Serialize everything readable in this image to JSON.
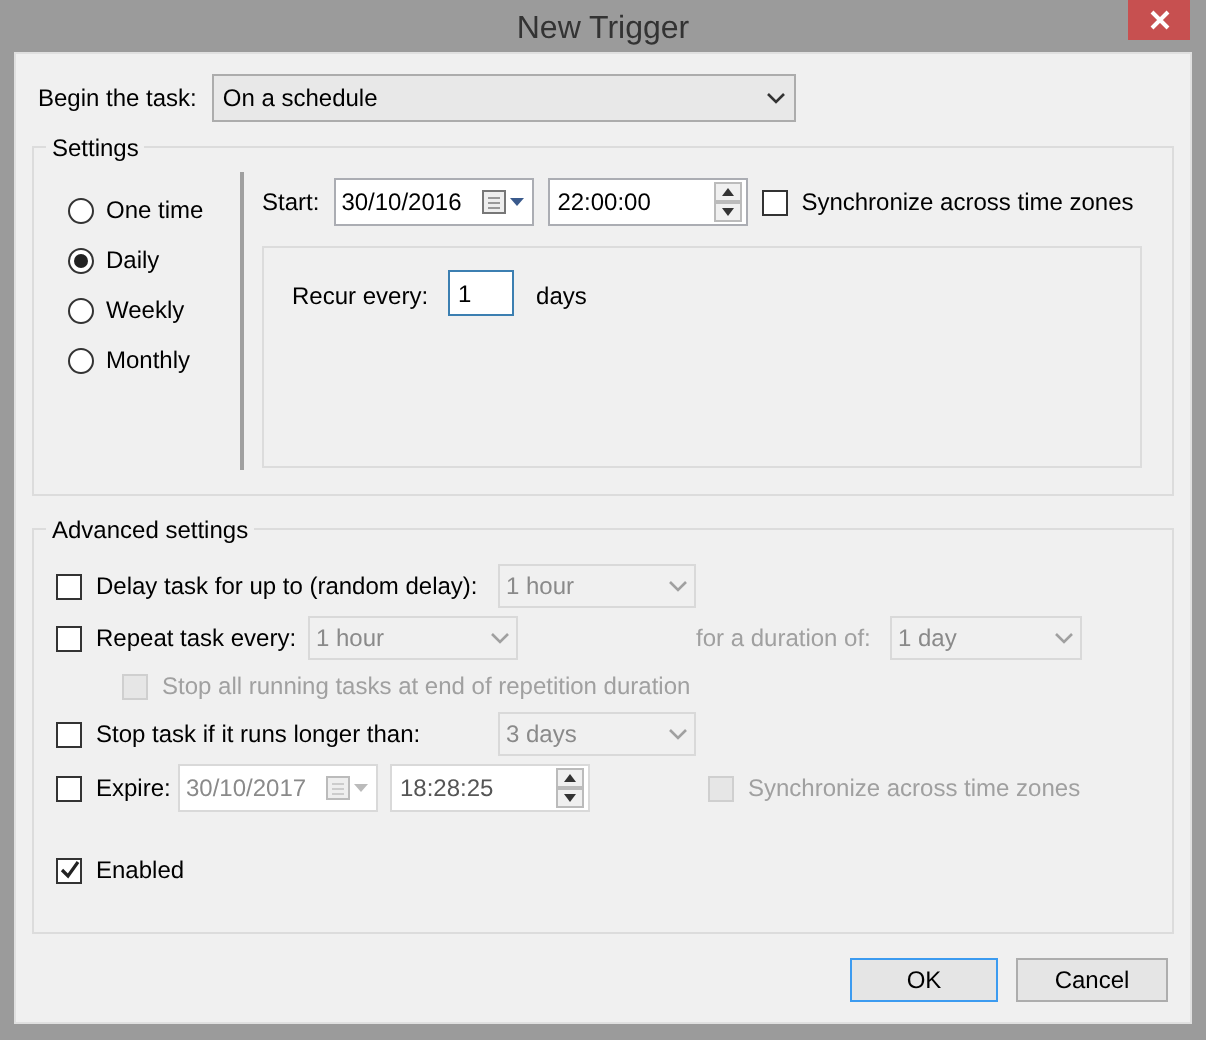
{
  "window": {
    "title": "New Trigger"
  },
  "begin_task": {
    "label": "Begin the task:",
    "value": "On a schedule"
  },
  "settings": {
    "title": "Settings",
    "schedules": [
      {
        "label": "One time",
        "selected": false
      },
      {
        "label": "Daily",
        "selected": true
      },
      {
        "label": "Weekly",
        "selected": false
      },
      {
        "label": "Monthly",
        "selected": false
      }
    ],
    "start": {
      "label": "Start:",
      "date": "30/10/2016",
      "time": "22:00:00"
    },
    "sync": {
      "label": "Synchronize across time zones",
      "checked": false,
      "disabled": false
    },
    "recur": {
      "label": "Recur every:",
      "value": "1",
      "unit": "days"
    }
  },
  "advanced": {
    "title": "Advanced settings",
    "delay": {
      "label": "Delay task for up to (random delay):",
      "checked": false,
      "value": "1 hour"
    },
    "repeat": {
      "label": "Repeat task every:",
      "checked": false,
      "value": "1 hour"
    },
    "duration": {
      "label": "for a duration of:",
      "value": "1 day"
    },
    "stop_all": {
      "label": "Stop all running tasks at end of repetition duration",
      "checked": false,
      "disabled": true
    },
    "stop_task": {
      "label": "Stop task if it runs longer than:",
      "checked": false,
      "value": "3 days"
    },
    "expire": {
      "label": "Expire:",
      "checked": false,
      "date": "30/10/2017",
      "time": "18:28:25"
    },
    "sync": {
      "label": "Synchronize across time zones",
      "checked": false,
      "disabled": true
    },
    "enabled": {
      "label": "Enabled",
      "checked": true
    }
  },
  "buttons": [
    {
      "label": "OK",
      "focused": true
    },
    {
      "label": "Cancel",
      "focused": false
    }
  ]
}
